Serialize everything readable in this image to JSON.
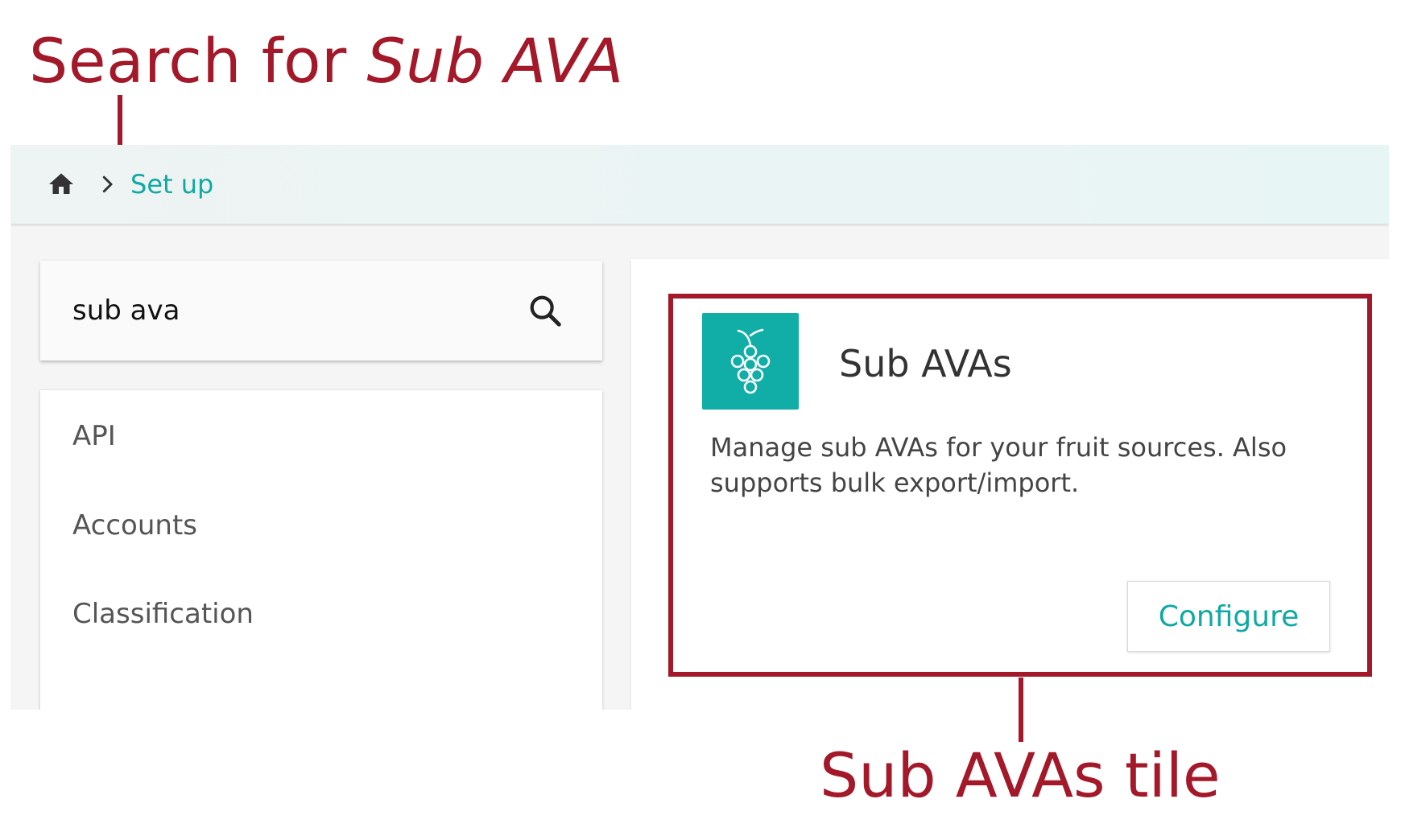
{
  "annotations": {
    "title_prefix": "Search for ",
    "title_emphasis": "Sub AVA",
    "bottom_label": "Sub AVAs tile",
    "color": "#a3192a"
  },
  "header": {
    "home_icon": "home-icon",
    "separator_icon": "chevron-right-icon",
    "breadcrumb": "Set up"
  },
  "search": {
    "value": "sub ava",
    "icon": "search-icon"
  },
  "nav": {
    "items": [
      {
        "label": "API"
      },
      {
        "label": "Accounts"
      },
      {
        "label": "Classification"
      }
    ]
  },
  "tile": {
    "icon": "grapes-icon",
    "icon_bg": "#10aea7",
    "title": "Sub AVAs",
    "description": "Manage sub AVAs for your fruit sources. Also supports bulk export/import.",
    "button_label": "Configure",
    "accent": "#10a9a3"
  }
}
